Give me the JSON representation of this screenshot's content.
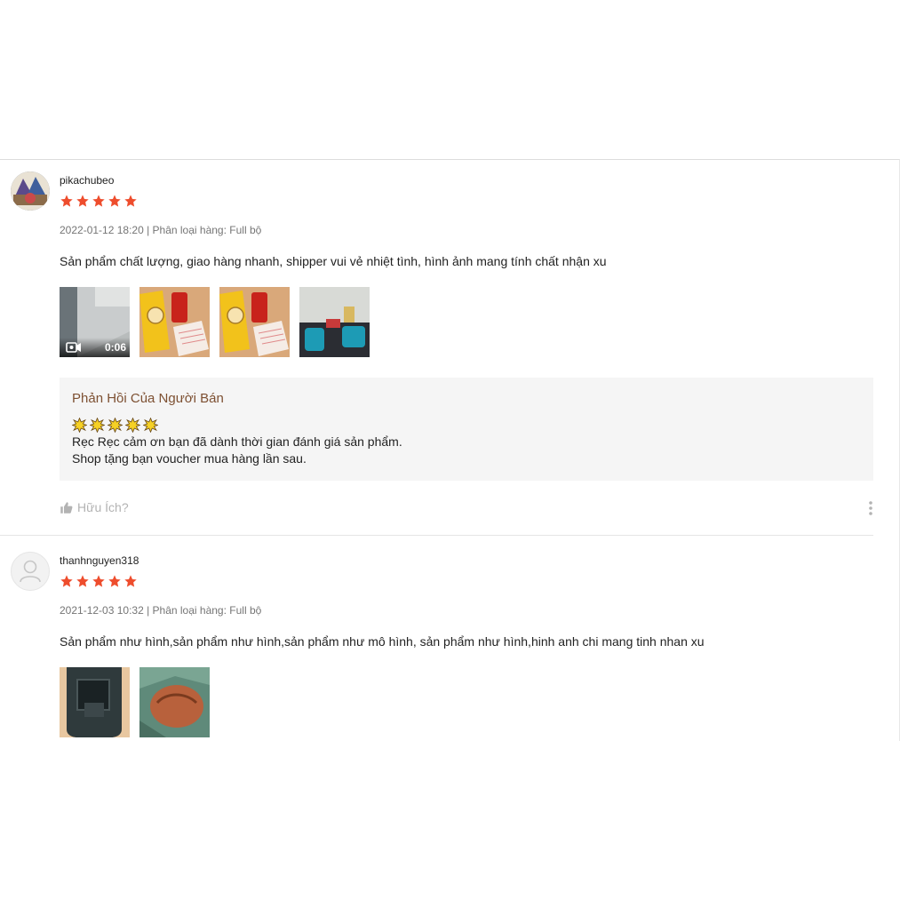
{
  "reviews": [
    {
      "username": "pikachubeo",
      "rating": 5,
      "meta": "2022-01-12 18:20 | Phân loại hàng: Full bộ",
      "content": "Sản phẩm chất lượng, giao hàng nhanh, shipper vui vẻ nhiệt tình, hình ảnh mang tính chất nhận xu",
      "video_duration": "0:06",
      "seller_reply": {
        "title": "Phản Hồi Của Người Bán",
        "line1": "Rẹc Rẹc cảm ơn bạn đã dành thời gian đánh giá sản phẩm.",
        "line2": "Shop tặng bạn voucher mua hàng lần sau."
      },
      "helpful_label": "Hữu Ích?"
    },
    {
      "username": "thanhnguyen318",
      "rating": 5,
      "meta": "2021-12-03 10:32 | Phân loại hàng: Full bộ",
      "content": "Sản phẩm như hình,sản phẩm như hình,sản phẩm như mô hình, sản phẩm như hình,hinh anh chi mang tinh nhan xu"
    }
  ],
  "colors": {
    "star": "#ee4d2d",
    "reply_title": "#7d5032"
  },
  "icons": {
    "video": "video-camera-icon",
    "helpful": "thumbs-up-icon",
    "more": "more-vertical-icon",
    "reply_star": "sparkle-star-icon",
    "default_avatar": "user-icon"
  }
}
